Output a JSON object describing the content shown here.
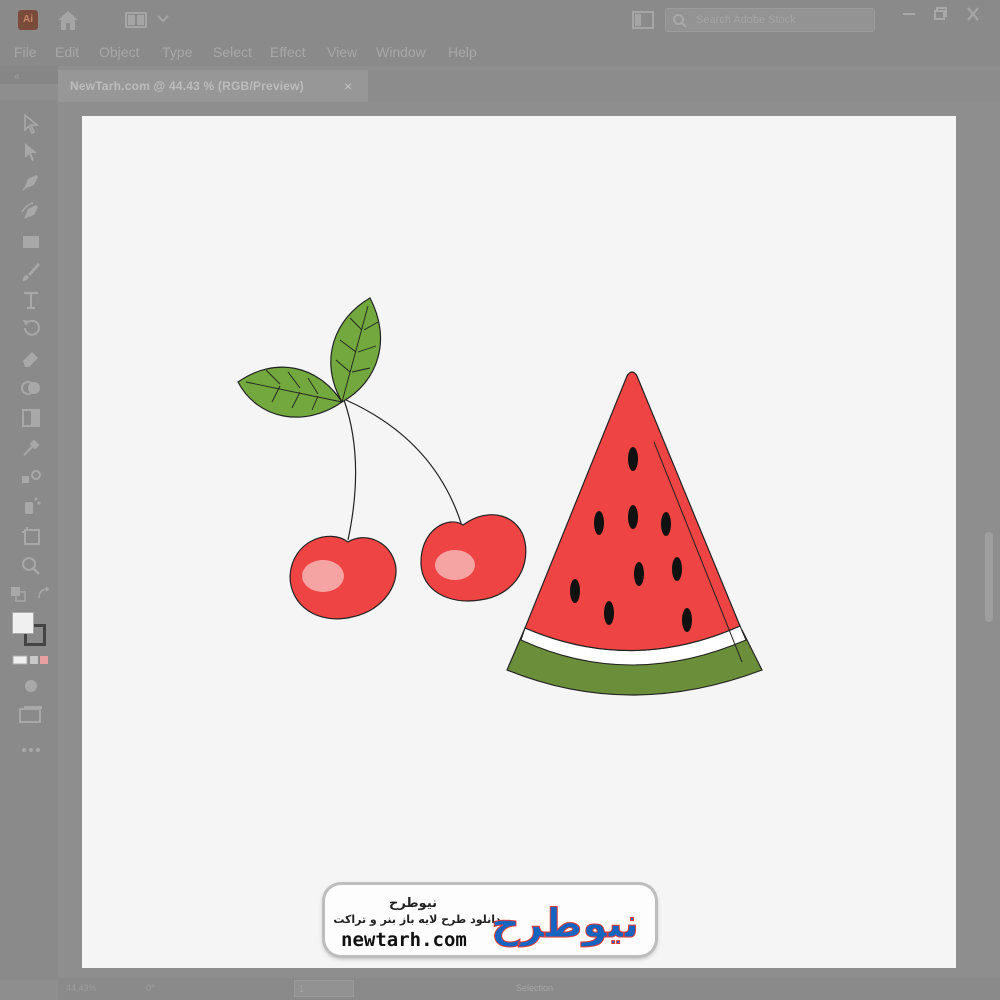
{
  "app": {
    "logo_text": "Ai"
  },
  "search": {
    "placeholder": "Search Adobe Stock"
  },
  "menu": [
    "File",
    "Edit",
    "Object",
    "Type",
    "Select",
    "Effect",
    "View",
    "Window",
    "Help"
  ],
  "panel": {
    "collapse_glyph": "«"
  },
  "document_tab": {
    "label": "NewTarh.com @ 44.43 % (RGB/Preview)",
    "close": "×"
  },
  "tools": [
    "selection-tool",
    "direct-selection-tool",
    "pen-tool",
    "curvature-tool",
    "rectangle-tool",
    "paintbrush-tool",
    "type-tool",
    "rotate-tool",
    "eraser-tool",
    "shape-builder-tool",
    "gradient-tool",
    "eyedropper-tool",
    "blend-tool",
    "symbol-sprayer-tool",
    "artboard-tool",
    "zoom-tool"
  ],
  "artwork": {
    "colors": {
      "cherry": "#ef4444",
      "leaf": "#72a83e",
      "rind_green": "#6b8e3a",
      "rind_white": "#ffffff",
      "flesh": "#ef4444",
      "seed": "#111111"
    }
  },
  "watermark": {
    "brand_fa": "نیوطرح",
    "logo_fa": "نیوطرح",
    "tagline_fa": "دانلود طرح لایه باز بنر و تراکت",
    "url": "newtarh.com"
  },
  "status": {
    "zoom": "44.43%",
    "rotation": "0°",
    "page": "1",
    "mode": "Selection"
  }
}
